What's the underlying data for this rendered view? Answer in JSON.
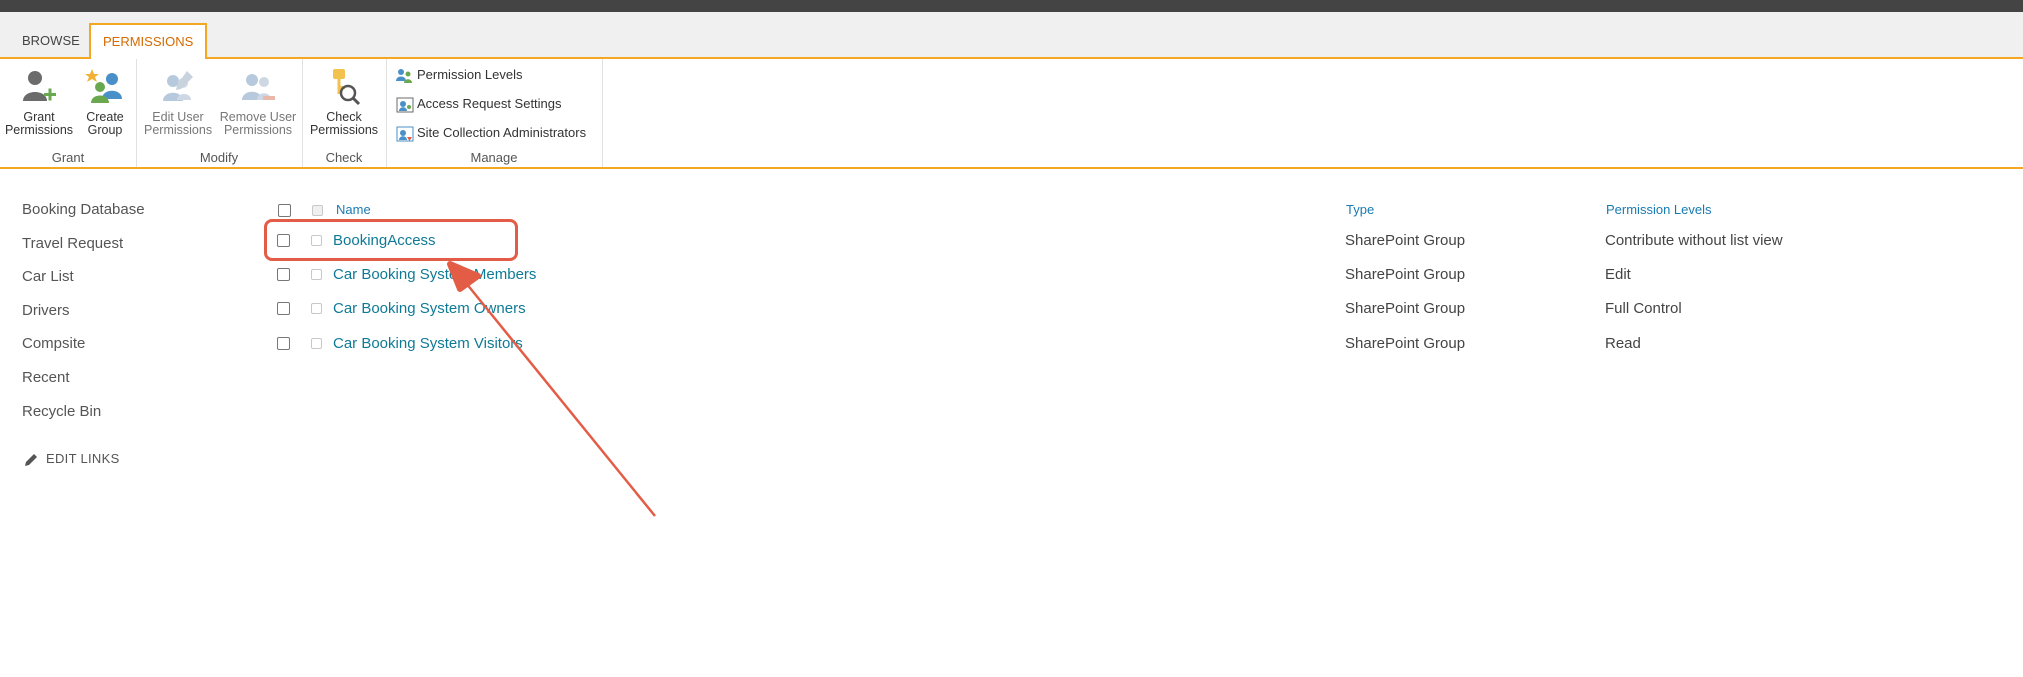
{
  "tabs": [
    {
      "label": "BROWSE"
    },
    {
      "label": "PERMISSIONS"
    }
  ],
  "ribbon": {
    "grant": {
      "label": "Grant",
      "grant_permissions": [
        "Grant",
        "Permissions"
      ],
      "create_group": [
        "Create",
        "Group"
      ]
    },
    "modify": {
      "label": "Modify",
      "edit_user_permissions": [
        "Edit User",
        "Permissions"
      ],
      "remove_user_permissions": [
        "Remove User",
        "Permissions"
      ]
    },
    "check": {
      "label": "Check",
      "check_permissions": [
        "Check",
        "Permissions"
      ]
    },
    "manage": {
      "label": "Manage",
      "items": [
        {
          "label": "Permission Levels"
        },
        {
          "label": "Access Request Settings"
        },
        {
          "label": "Site Collection Administrators"
        }
      ]
    }
  },
  "quicklaunch": {
    "items": [
      {
        "label": "Booking Database"
      },
      {
        "label": "Travel Request"
      },
      {
        "label": "Car List"
      },
      {
        "label": "Drivers"
      },
      {
        "label": "Compsite"
      },
      {
        "label": "Recent"
      },
      {
        "label": "Recycle Bin"
      }
    ],
    "edit_links": "EDIT LINKS"
  },
  "table": {
    "headers": {
      "name": "Name",
      "type": "Type",
      "permission_levels": "Permission Levels"
    },
    "rows": [
      {
        "name": "BookingAccess",
        "type": "SharePoint Group",
        "permission": "Contribute without list view"
      },
      {
        "name": "Car Booking System Members",
        "type": "SharePoint Group",
        "permission": "Edit"
      },
      {
        "name": "Car Booking System Owners",
        "type": "SharePoint Group",
        "permission": "Full Control"
      },
      {
        "name": "Car Booking System Visitors",
        "type": "SharePoint Group",
        "permission": "Read"
      }
    ]
  },
  "colors": {
    "accent": "#f5a623",
    "link": "#0f7a96",
    "header_link": "#1a7bb3",
    "annotation": "#e35d46"
  }
}
